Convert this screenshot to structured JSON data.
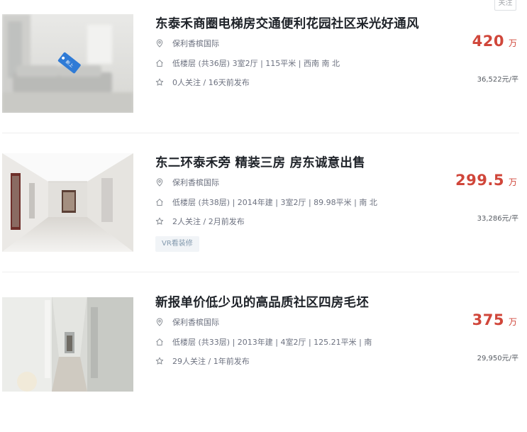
{
  "follow_label": "关注",
  "listings": [
    {
      "title": "东泰禾商圈电梯房交通便利花园社区采光好通风",
      "community": "保利香槟国际",
      "info": "低楼层 (共36层) 3室2厅 | 115平米 | 西南 南 北",
      "follow": "0人关注 / 16天前发布",
      "price": "420",
      "price_unit": "万",
      "unit_price": "36,522元/平",
      "image_label": "新上"
    },
    {
      "title": "东二环泰禾旁 精装三房 房东诚意出售",
      "community": "保利香槟国际",
      "info": "低楼层 (共38层) | 2014年建 | 3室2厅 | 89.98平米 | 南 北",
      "follow": "2人关注 / 2月前发布",
      "price": "299.5",
      "price_unit": "万",
      "unit_price": "33,286元/平",
      "tag": "VR看装修"
    },
    {
      "title": "新报单价低少见的高品质社区四房毛坯",
      "community": "保利香槟国际",
      "info": "低楼层 (共33层) | 2013年建 | 4室2厅 | 125.21平米 | 南",
      "follow": "29人关注 / 1年前发布",
      "price": "375",
      "price_unit": "万",
      "unit_price": "29,950元/平"
    }
  ],
  "colors": {
    "price": "#d0463a",
    "title": "#1f2329",
    "meta": "#6d7280",
    "tag_bg": "#f1f4f7",
    "tag_text": "#849aae"
  },
  "icons": {
    "community": "location-pin-icon",
    "info": "house-icon",
    "follow": "star-icon"
  }
}
